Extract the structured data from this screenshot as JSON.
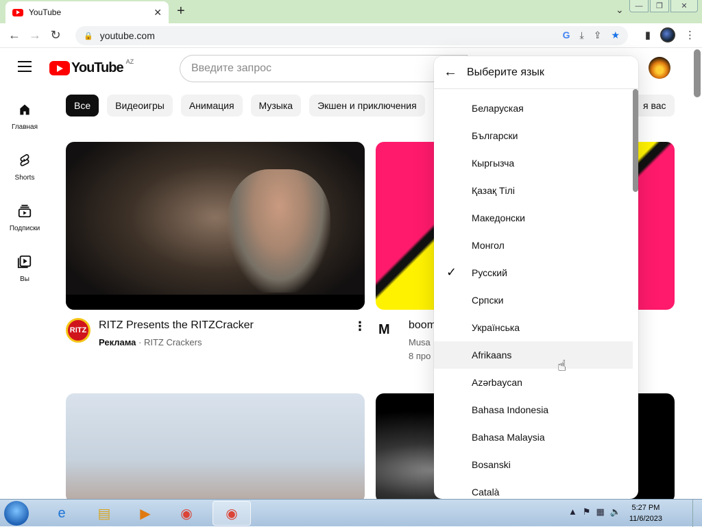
{
  "browser": {
    "tab_title": "YouTube",
    "tab_close": "✕",
    "new_tab": "+",
    "url": "youtube.com",
    "window_buttons": [
      "—",
      "❐",
      "✕"
    ]
  },
  "youtube": {
    "logo_text": "YouTube",
    "region": "AZ",
    "search_placeholder": "Введите запрос",
    "chips": [
      "Все",
      "Видеоигры",
      "Анимация",
      "Музыка",
      "Экшен и приключения"
    ],
    "chip_tail": "я вас",
    "guide": [
      "Главная",
      "Shorts",
      "Подписки",
      "Вы"
    ]
  },
  "videos": [
    {
      "title": "RITZ Presents the RITZCracker",
      "ad_label": "Реклама",
      "separator": " · ",
      "channel": "RITZ Crackers",
      "avatar_text": "RITZ"
    },
    {
      "title": "boom",
      "channel": "Musa",
      "views": "8 про",
      "avatar_text": "M"
    }
  ],
  "language_menu": {
    "title": "Выберите язык",
    "selected": "Русский",
    "hovered": "Afrikaans",
    "items": [
      "Беларуская",
      "Български",
      "Кыргызча",
      "Қазақ Тілі",
      "Македонски",
      "Монгол",
      "Русский",
      "Српски",
      "Українська",
      "Afrikaans",
      "Azərbaycan",
      "Bahasa Indonesia",
      "Bahasa Malaysia",
      "Bosanski",
      "Català"
    ]
  },
  "taskbar": {
    "time": "5:27 PM",
    "date": "11/6/2023"
  }
}
